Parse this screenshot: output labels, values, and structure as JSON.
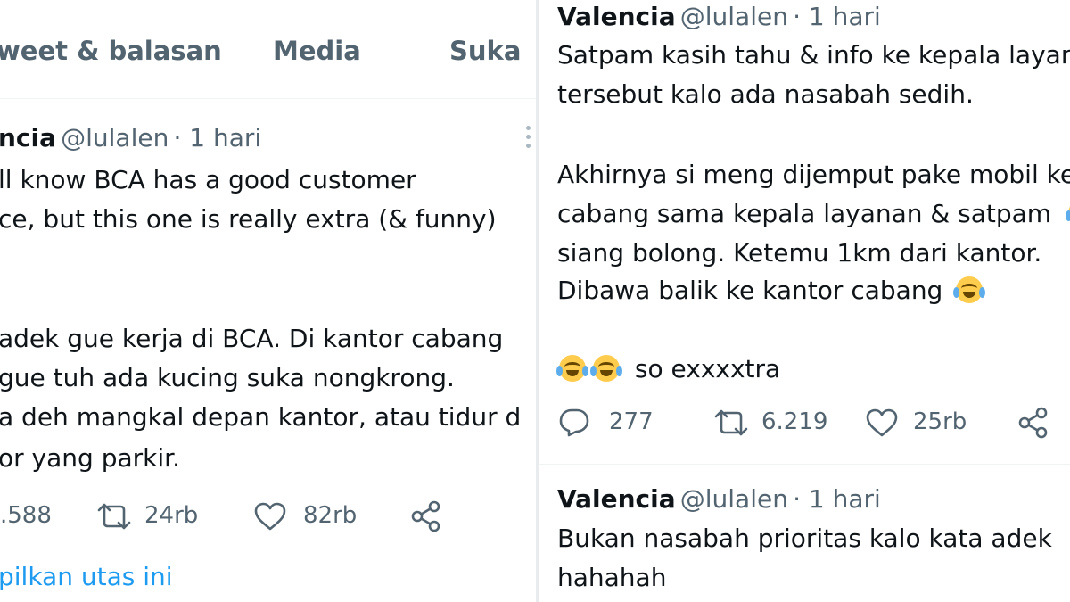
{
  "left": {
    "tabs": [
      "weet & balasan",
      "Media",
      "Suka"
    ],
    "tweet": {
      "name": "ncia",
      "handle": "@lulalen",
      "time": "· 1 hari",
      "lines": [
        "ll know BCA has a good customer",
        "ce, but this one is really extra (& funny)",
        "adek gue kerja di BCA. Di kantor cabang",
        " gue tuh ada kucing suka nongkrong.",
        "a deh mangkal depan kantor, atau tidur d",
        "or yang parkir."
      ],
      "replies": ".588",
      "retweets": "24rb",
      "likes": "82rb",
      "show_thread": "pilkan utas ini"
    }
  },
  "right": {
    "tweet1": {
      "name": "Valencia",
      "handle": "@lulalen",
      "time": "· 1 hari",
      "lines": [
        "Satpam kasih tahu & info ke kepala layan",
        "tersebut kalo ada nasabah sedih.",
        "Akhirnya si meng dijemput pake mobil ke",
        "cabang sama kepala layanan & satpam",
        "siang bolong. Ketemu 1km dari kantor.",
        "Dibawa balik ke kantor cabang",
        "so exxxxtra"
      ],
      "replies": "277",
      "retweets": "6.219",
      "likes": "25rb"
    },
    "tweet2": {
      "name": "Valencia",
      "handle": "@lulalen",
      "time": "· 1 hari",
      "lines": [
        "Bukan nasabah prioritas kalo kata adek",
        "hahahah"
      ]
    }
  },
  "icons": {
    "reply": "reply-bubble-icon",
    "retweet": "retweet-icon",
    "like": "heart-icon",
    "share": "share-icon",
    "more": "more-vertical-icon",
    "emoji": "face-with-tears-of-joy-emoji"
  },
  "colors": {
    "text": "#0f1419",
    "muted": "#536471",
    "link": "#1d9bf0",
    "divider": "#e9ecef"
  }
}
